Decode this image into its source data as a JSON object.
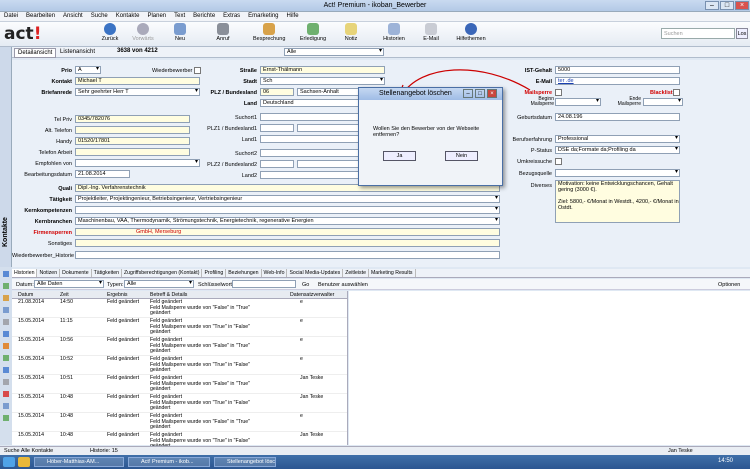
{
  "window": {
    "title": "Act! Premium - ikoban_Bewerber"
  },
  "menu": [
    "Datei",
    "Bearbeiten",
    "Ansicht",
    "Suche",
    "Kontakte",
    "Planen",
    "Text",
    "Berichte",
    "Extras",
    "Emarketing",
    "Hilfe"
  ],
  "toolbar": {
    "logo": "act!",
    "buttons": [
      "Zurück",
      "Vorwärts",
      "Neu",
      "Anruf",
      "Besprechung",
      "Erledigung",
      "Notiz",
      "Historien",
      "E-Mail",
      "Hilfethemen"
    ],
    "search_placeholder": "Suchen",
    "search_button": "Los"
  },
  "viewbar": {
    "detail": "Detailansicht",
    "list": "Listenansicht",
    "record": "3638 von 4212",
    "lookup": "Alle"
  },
  "sidebar": {
    "label": "Kontakte"
  },
  "form": {
    "prio_label": "Prio",
    "prio": "A",
    "wiederbewerber": "Wiederbewerber",
    "kontakt_label": "Kontakt",
    "kontakt": "Michael T",
    "briefanrede_label": "Briefanrede",
    "briefanrede": "Sehr geehrter Herr T",
    "strasse_label": "Straße",
    "strasse": "Ernst-Thälmann",
    "stadt_label": "Stadt",
    "stadt": "Sch",
    "plz_label": "PLZ / Bundesland",
    "plz": "06",
    "bundesland": "Sachsen-Anhalt",
    "land_label": "Land",
    "land": "Deutschland",
    "suchort1": "Suchort1",
    "plz1": "PLZ1 / Bundesland1",
    "land1": "Land1",
    "suchort2": "Suchort2",
    "plz2": "PLZ2 / Bundesland2",
    "land2": "Land2",
    "telpriv_label": "Tel Priv",
    "telpriv": "0345/782076",
    "alttel_label": "Alt. Telefon",
    "handy_label": "Handy",
    "handy": "01520/17801",
    "telarb_label": "Telefon Arbeit",
    "empf_label": "Empfohlen von",
    "bearb_label": "Bearbeitungsdatum",
    "bearb": "21.08.2014",
    "ist_label": "IST-Gehalt",
    "ist": "5000",
    "email_label": "E-Mail",
    "email": "ter                    .de",
    "mailsperre_label": "Mailsperre",
    "blacklist": "Blacklist",
    "beginn": "Beginn Mailsperre",
    "ende": "Ende Mailsperre",
    "geb_label": "Geburtsdatum",
    "geb": "24.08.196",
    "beruf_label": "Berufserfahrung",
    "beruf": "Professional",
    "pstatus_label": "P-Status",
    "pstatus": "DSE da;Formate da;Profiling da",
    "umkreis_label": "Umkreissuche",
    "bezug_label": "Bezugsquelle",
    "diverses_label": "Diverses",
    "diverses": "Motivation: keine Entwicklungschancen, Gehalt gering (3000 €).\n\nZiel: 5800,- €/Monat in Westdt., 4200,- €/Monat in Ostdt.",
    "quali_label": "Quali",
    "quali": "Dipl.-Ing. Verfahrenstechnik",
    "taet_label": "Tätigkeit",
    "taet": "Projektleiter, Projektingenieur, Betriebsingenieur, Vertriebsingenieur",
    "kernk_label": "Kernkompetenzen",
    "kernb_label": "Kernbranchen",
    "kernb": "Maschinenbau, VAA, Thermodynamik, Strömungstechnik, Energietechnik, regenerative Energien",
    "firmen_label": "Firmensperren",
    "firmen": "GmbH, Merseburg",
    "sonst_label": "Sonstiges",
    "wb_label": "Wiederbewerber_Historie"
  },
  "dialog": {
    "title": "Stellenangebot löschen",
    "message": "Wollen Sie den Bewerber von der Webseite entfernen?",
    "yes": "Ja",
    "no": "Nein"
  },
  "tabs": [
    "Historien",
    "Notizen",
    "Dokumente",
    "Tätigkeiten",
    "Zugriffsberechtigungen (Kontakt)",
    "Profiling",
    "Beziehungen",
    "Web-Info",
    "Social Media-Updates",
    "Zeitleiste",
    "Marketing Results"
  ],
  "filters": {
    "datum_label": "Datum:",
    "datum": "Alle Daten",
    "typen_label": "Typen:",
    "typen": "Alle",
    "schluessel": "Schlüsselwort:",
    "go": "Go",
    "benutzer": "Benutzer auswählen",
    "optionen": "Optionen"
  },
  "grid": {
    "headers": [
      "Datum",
      "Zeit",
      "Ergebnis",
      "Betreff & Details",
      "Datensatzverwalter"
    ],
    "rows": [
      [
        "21.08.2014",
        "14:50",
        "Feld geändert",
        "Feld geändert\nFeld Mailsperre wurde von \"False\" in \"True\"\ngeändert",
        "e"
      ],
      [
        "15.05.2014",
        "11:15",
        "Feld geändert",
        "Feld geändert\nFeld Mailsperre wurde von \"True\" in \"False\"\ngeändert",
        "e"
      ],
      [
        "15.05.2014",
        "10:56",
        "Feld geändert",
        "Feld geändert\nFeld Mailsperre wurde von \"False\" in \"True\"\ngeändert",
        "e"
      ],
      [
        "15.05.2014",
        "10:52",
        "Feld geändert",
        "Feld geändert\nFeld Mailsperre wurde von \"True\" in \"False\"\ngeändert",
        "e"
      ],
      [
        "15.05.2014",
        "10:51",
        "Feld geändert",
        "Feld geändert\nFeld Mailsperre wurde von \"False\" in \"True\"\ngeändert",
        "Jan Teske"
      ],
      [
        "15.05.2014",
        "10:48",
        "Feld geändert",
        "Feld geändert\nFeld Mailsperre wurde von \"True\" in \"False\"\ngeändert",
        "Jan Teske"
      ],
      [
        "15.05.2014",
        "10:48",
        "Feld geändert",
        "Feld geändert\nFeld Mailsperre wurde von \"False\" in \"True\"\ngeändert",
        "e"
      ],
      [
        "15.05.2014",
        "10:48",
        "Feld geändert",
        "Feld geändert\nFeld Mailsperre wurde von \"True\" in \"False\"\ngeändert",
        "Jan Teske"
      ]
    ]
  },
  "status": {
    "left": "Suche Alle Kontakte",
    "history": "Historie: 15",
    "user": "Jan Teske"
  },
  "taskbar": {
    "items": [
      "Höber-Matthias-AM...",
      "Act! Premium - ikob...",
      "Stellenangebot lösch..."
    ],
    "clock": "14:50"
  },
  "colors": {
    "accent": "#d20000",
    "title": "#b3c9e6"
  }
}
